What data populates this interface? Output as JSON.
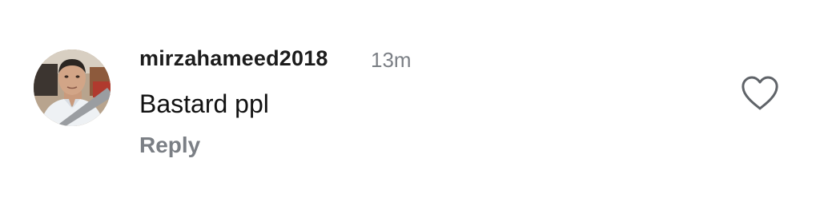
{
  "comment": {
    "username": "mirzahameed2018",
    "timestamp": "13m",
    "text": "Bastard ppl",
    "reply_label": "Reply",
    "avatar_icon": "user-profile-photo",
    "like_icon": "heart-outline-icon"
  }
}
